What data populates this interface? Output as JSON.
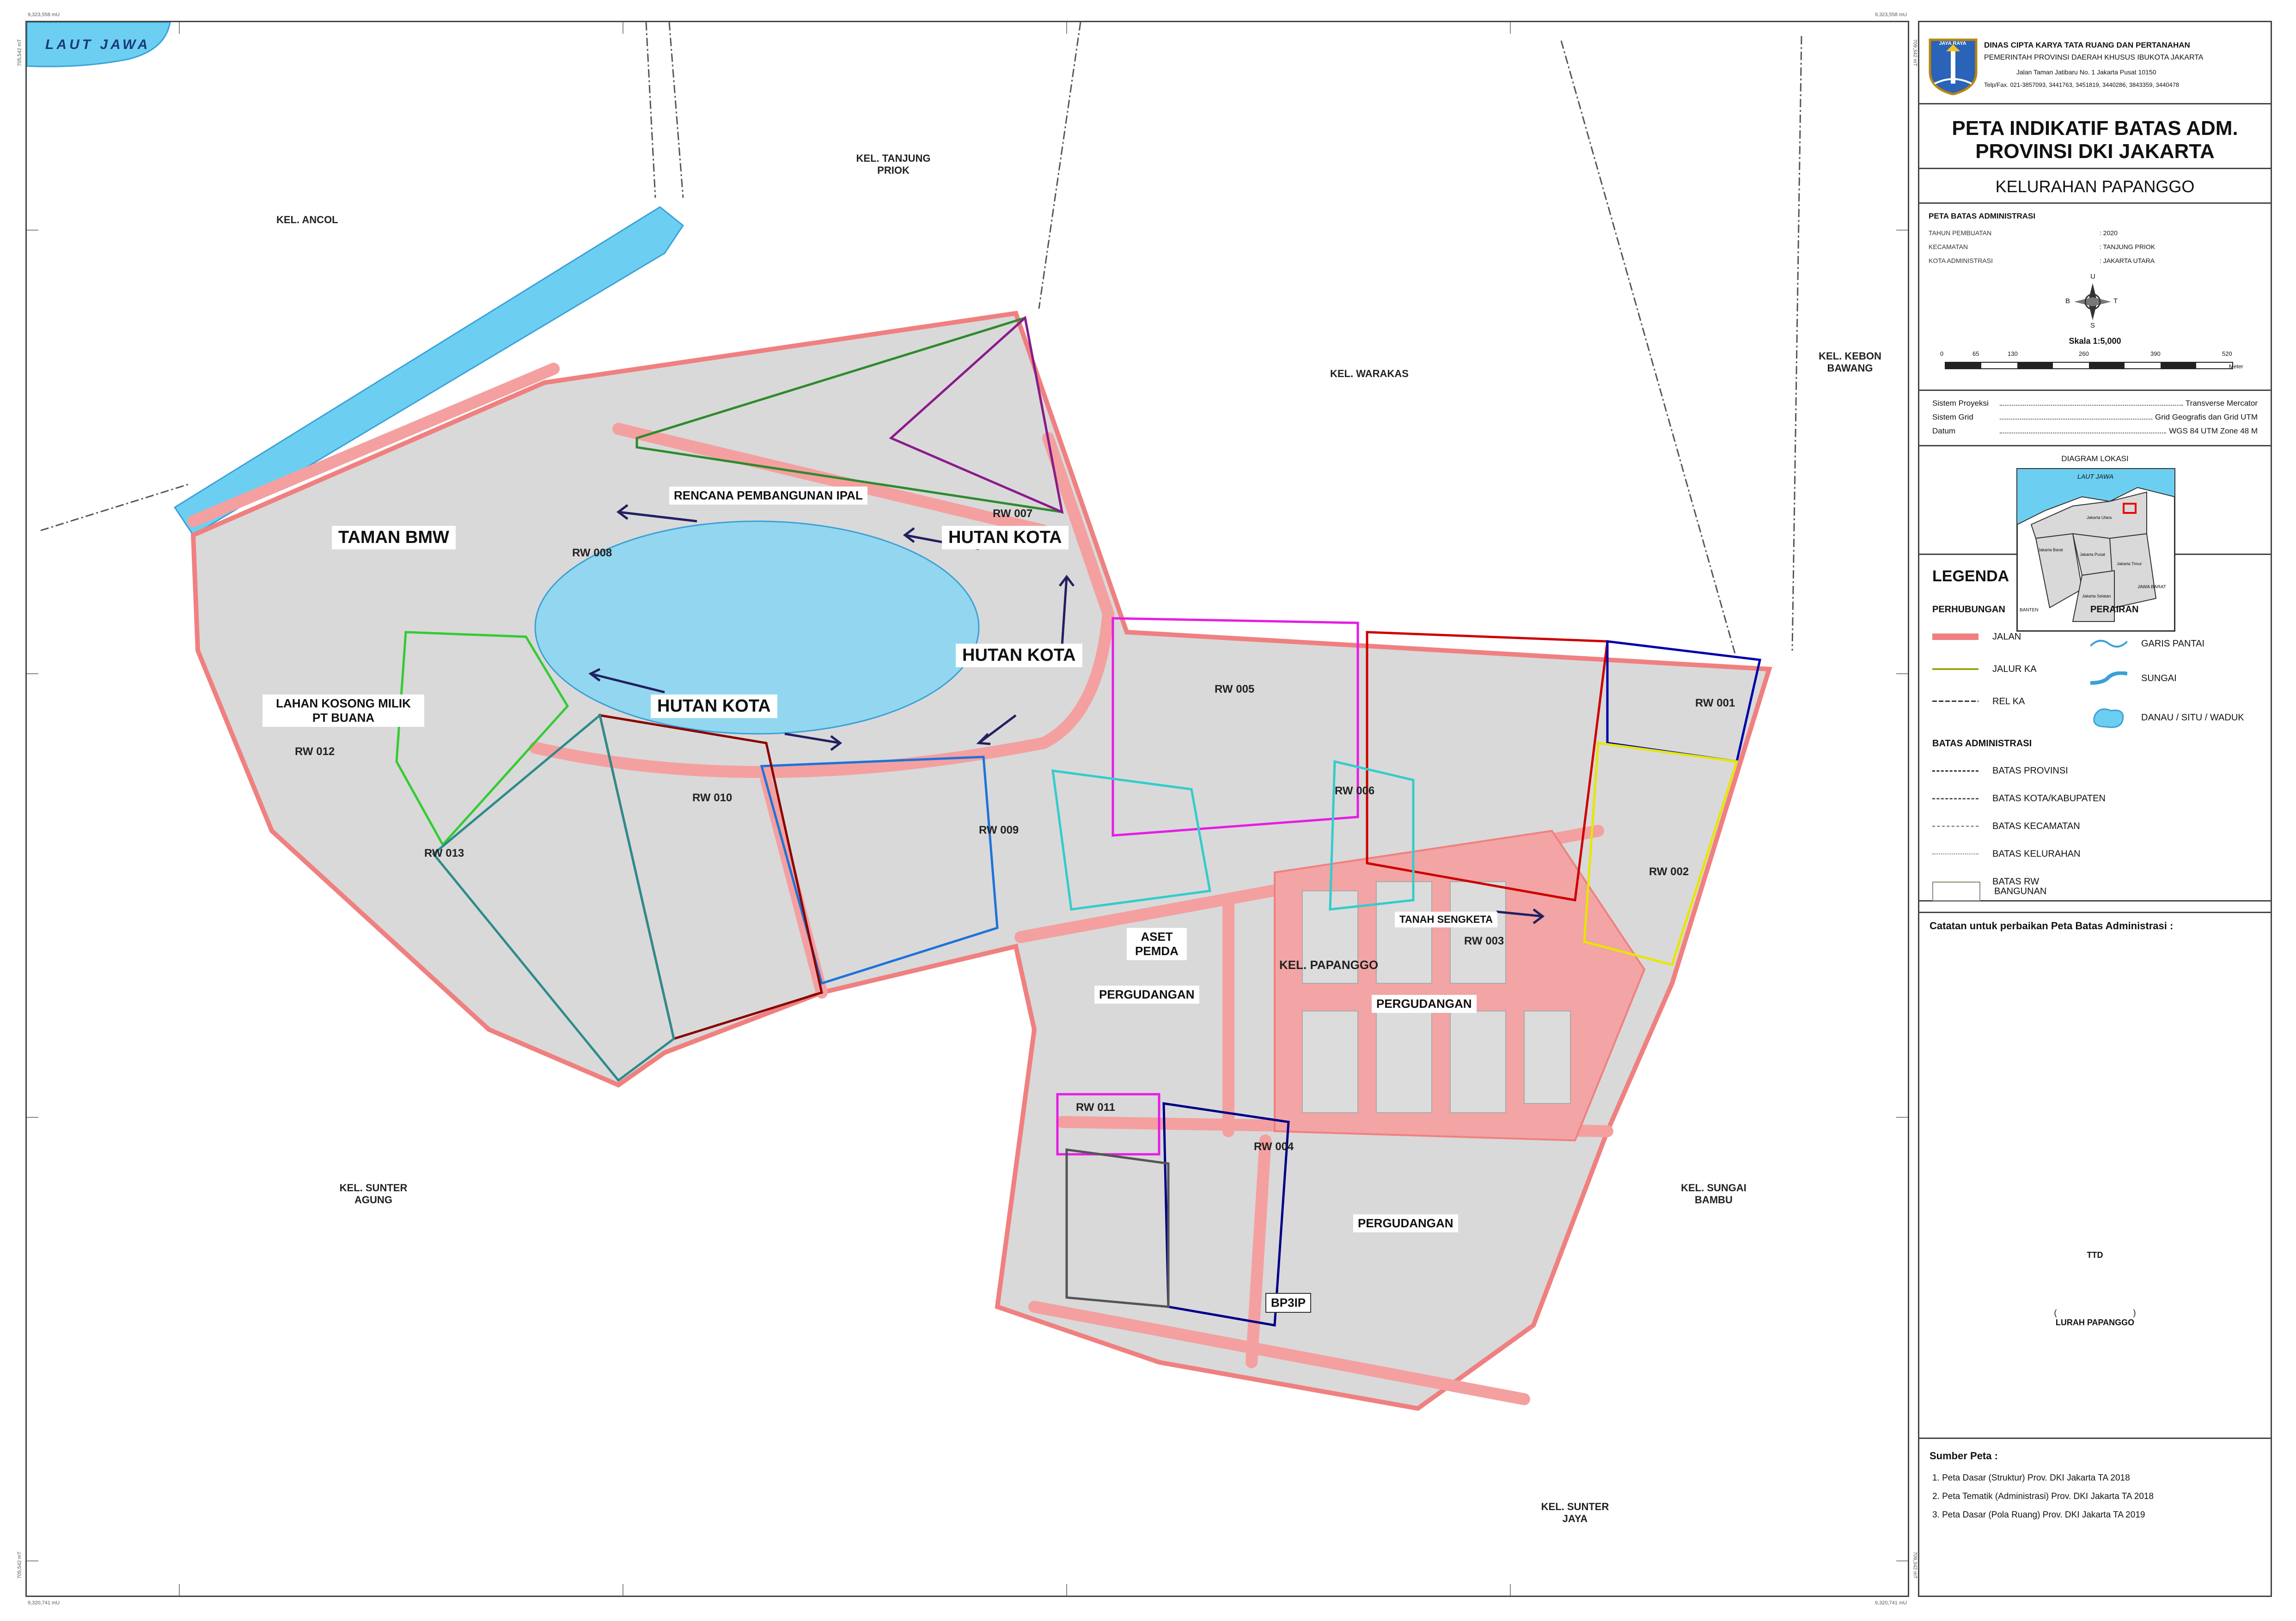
{
  "header": {
    "org_line1": "DINAS CIPTA KARYA TATA RUANG DAN PERTANAHAN",
    "org_line2": "PEMERINTAH PROVINSI DAERAH KHUSUS IBUKOTA JAKARTA",
    "address": "Jalan Taman Jatibaru No. 1 Jakarta Pusat 10150",
    "phone": "Telp/Fax. 021-3857093, 3441763, 3451819, 3440286, 3843359, 3440478",
    "logo_text": "JAYA RAYA"
  },
  "title": {
    "line1": "PETA INDIKATIF BATAS ADM.",
    "line2": "PROVINSI DKI JAKARTA",
    "kelurahan": "KELURAHAN PAPANGGO"
  },
  "meta": {
    "heading": "PETA BATAS ADMINISTRASI",
    "rows": [
      {
        "k": "TAHUN PEMBUATAN",
        "v": ": 2020"
      },
      {
        "k": "KECAMATAN",
        "v": ": TANJUNG PRIOK"
      },
      {
        "k": "KOTA ADMINISTRASI",
        "v": ": JAKARTA UTARA"
      }
    ]
  },
  "compass": {
    "n": "U",
    "s": "S",
    "e": "T",
    "w": "B"
  },
  "scale": {
    "label": "Skala 1:5,000",
    "ticks": [
      "0",
      "65",
      "130",
      "260",
      "390",
      "520"
    ],
    "unit": "Meter"
  },
  "system": [
    {
      "k": "Sistem Proyeksi",
      "v": "Transverse Mercator"
    },
    {
      "k": "Sistem Grid",
      "v": "Grid Geografis dan Grid UTM"
    },
    {
      "k": "Datum",
      "v": "WGS 84  UTM Zone 48 M"
    }
  ],
  "location": {
    "heading": "DIAGRAM LOKASI",
    "sea": "LAUT JAWA",
    "labels": [
      "Jakarta Utara",
      "Jakarta Barat",
      "Jakarta Pusat",
      "Jakarta Timur",
      "Jakarta Selatan",
      "BANTEN",
      "JAWA BARAT"
    ]
  },
  "legend": {
    "heading": "LEGENDA",
    "perhubungan": {
      "heading": "PERHUBUNGAN",
      "items": [
        {
          "label": "JALAN",
          "color": "#f08080"
        },
        {
          "label": "JALUR KA",
          "color": "#9aa814"
        },
        {
          "label": "REL KA",
          "color": "#333333"
        }
      ]
    },
    "perairan": {
      "heading": "PERAIRAN",
      "items": [
        {
          "label": "GARIS PANTAI",
          "color": "#3aa0d8"
        },
        {
          "label": "SUNGAI",
          "color": "#3aa0d8"
        },
        {
          "label": "DANAU / SITU / WADUK",
          "color": "#6ccff2"
        }
      ]
    },
    "batas": {
      "heading": "BATAS ADMINISTRASI",
      "items": [
        {
          "label": "BATAS PROVINSI",
          "color": "#333333"
        },
        {
          "label": "BATAS KOTA/KABUPATEN",
          "color": "#555555"
        },
        {
          "label": "BATAS KECAMATAN",
          "color": "#666666"
        },
        {
          "label": "BATAS KELURAHAN",
          "color": "#777777"
        },
        {
          "label": "BATAS RW",
          "color": "#c8e070"
        },
        {
          "label": "BANGUNAN",
          "color": "#ffffff"
        }
      ]
    }
  },
  "notes": {
    "heading": "Catatan untuk perbaikan Peta Batas Administrasi :",
    "ttd": "TTD",
    "lurah": "LURAH PAPANGGO"
  },
  "sources": {
    "heading": "Sumber Peta :",
    "items": [
      "1.   Peta Dasar (Struktur) Prov. DKI Jakarta TA 2018",
      "2.   Peta Tematik (Administrasi) Prov. DKI Jakarta TA 2018",
      "3.   Peta Dasar (Pola Ruang) Prov. DKI Jakarta TA 2019"
    ]
  },
  "map": {
    "sea": "LAUT JAWA",
    "neighbors": [
      "KEL. ANCOL",
      "KEL. TANJUNG PRIOK",
      "KEL. WARAKAS",
      "KEL. KEBON BAWANG",
      "KEL. SUNTER AGUNG",
      "KEL. SUNGAI BAMBU",
      "KEL. SUNTER JAYA",
      "KEL. PAPANGGO"
    ],
    "big_labels": [
      "TAMAN BMW",
      "HUTAN KOTA",
      "HUTAN KOTA",
      "HUTAN KOTA"
    ],
    "area_labels": [
      "RENCANA PEMBANGUNAN IPAL",
      "LAHAN KOSONG MILIK PT BUANA",
      "ASET PEMDA",
      "PERGUDANGAN",
      "PERGUDANGAN",
      "PERGUDANGAN",
      "TANAH SENGKETA",
      "BP3IP"
    ],
    "rw": [
      "RW 001",
      "RW 002",
      "RW 003",
      "RW 004",
      "RW 005",
      "RW 006",
      "RW 007",
      "RW 008",
      "RW 009",
      "RW 010",
      "RW 011",
      "RW 012",
      "RW 013"
    ],
    "coords": {
      "top_left": "9,323,558 mU",
      "top_right": "9,323,558 mU",
      "bottom_left": "9,320,741 mU",
      "bottom_right": "9,320,741 mU",
      "left_top": "705,542 mT",
      "left_bottom": "705,542 mT",
      "right_top": "709,342 mT",
      "right_bottom": "709,342 mT"
    }
  }
}
